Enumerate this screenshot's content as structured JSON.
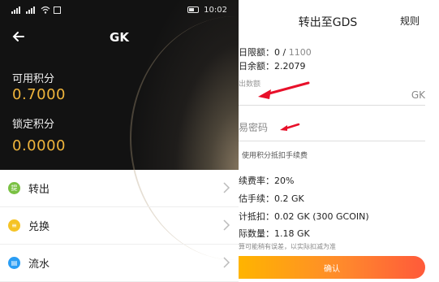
{
  "left_screen": {
    "status_bar": {
      "time": "10:02"
    },
    "nav": {
      "title": "GK",
      "back_icon": "arrow-left-icon"
    },
    "available": {
      "label": "可用积分",
      "value": "0.7000"
    },
    "locked": {
      "label": "锁定积分",
      "value": "0.0000"
    },
    "menu": [
      {
        "label": "转出",
        "icon": "transfer-icon",
        "color": "#7ac143"
      },
      {
        "label": "兑换",
        "icon": "exchange-icon",
        "color": "#f5c325"
      },
      {
        "label": "流水",
        "icon": "ledger-icon",
        "color": "#2a9df4"
      }
    ]
  },
  "right_screen": {
    "title": "转出至GDS",
    "rules_link": "规则",
    "daily_limit": {
      "label": "日限额：",
      "used": "0",
      "sep": " / ",
      "total": "1100"
    },
    "daily_remaining": {
      "label": "日余额：",
      "value": "2.2079"
    },
    "amount_field": {
      "placeholder": "出数额",
      "unit": "GK"
    },
    "password_field": {
      "placeholder": "易密码"
    },
    "use_points_note": "使用积分抵扣手续费",
    "fee_rate": {
      "label": "续费率：",
      "value": "20%"
    },
    "est_fee": {
      "label": "估手续：",
      "value": "0.2 GK"
    },
    "deduct": {
      "label": "计抵扣：",
      "value": "0.02 GK (300 GCOIN)"
    },
    "actual": {
      "label": "际数量：",
      "value": "1.18 GK"
    },
    "disclaimer": "算可能稍有误差，以实际扣减为准",
    "confirm_button": "确认"
  },
  "colors": {
    "accent": "#f0b53c",
    "annotation_arrow": "#e8102a"
  }
}
